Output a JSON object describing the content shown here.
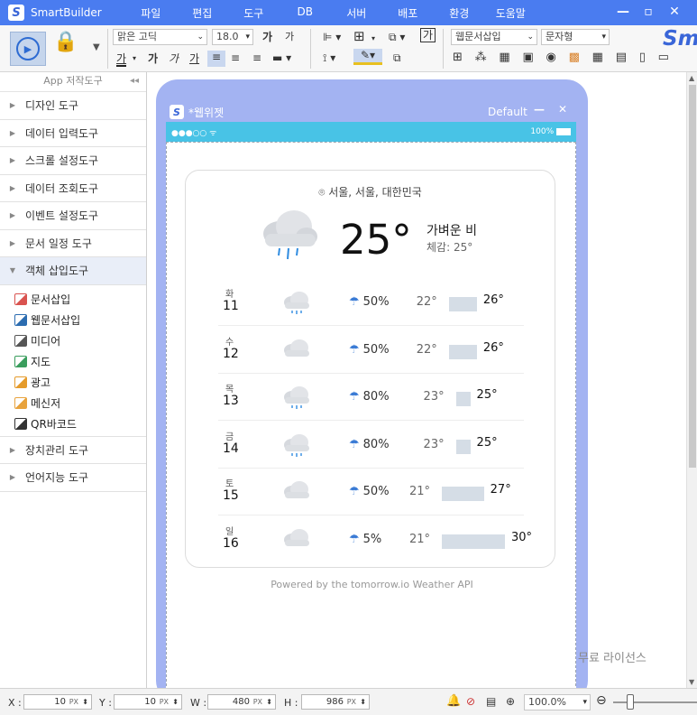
{
  "app": {
    "title": "SmartBuilder",
    "logo": "S"
  },
  "menu": [
    "파일",
    "편집",
    "도구",
    "DB",
    "서버",
    "배포",
    "환경",
    "도움말"
  ],
  "toolbar": {
    "font_name": "맑은 고딕",
    "font_size": "18.0",
    "widget_select": "웹문서삽입",
    "text_type": "문자형",
    "bold_glyph": "가",
    "italic_glyph": "가",
    "under_glyph": "가",
    "underline_glyph": "가",
    "increase_glyph": "가",
    "decrease_glyph": "가",
    "textbox_glyph": "가",
    "brand_partial": "Sm"
  },
  "left_panel": {
    "header": "App 저작도구",
    "sections_top": [
      "디자인 도구",
      "데이터 입력도구",
      "스크롤 설정도구",
      "데이터 조회도구",
      "이벤트 설정도구",
      "문서 일정 도구",
      "객체 삽입도구"
    ],
    "items": [
      {
        "label": "문서삽입",
        "color": "#d9534f"
      },
      {
        "label": "웹문서삽입",
        "color": "#2b6cb0"
      },
      {
        "label": "미디어",
        "color": "#555555"
      },
      {
        "label": "지도",
        "color": "#3a9d5d"
      },
      {
        "label": "광고",
        "color": "#e59b2b"
      },
      {
        "label": "메신저",
        "color": "#e8a33d"
      },
      {
        "label": "QR바코드",
        "color": "#333333"
      }
    ],
    "sections_bottom": [
      "장치관리 도구",
      "언어지능 도구"
    ]
  },
  "frame": {
    "title": "*웹위젯",
    "preset": "Default",
    "status_left": "●●●○○ ᯤ",
    "battery": "100%"
  },
  "weather": {
    "location": "서울, 서울, 대한민국",
    "temp": "25°",
    "condition": "가벼운 비",
    "feels_like": "체감: 25°",
    "days": [
      {
        "name": "화",
        "num": "11",
        "icon": "rain",
        "pop": "50%",
        "lo": "22°",
        "hi": "26°",
        "lo_val": 22,
        "hi_val": 26
      },
      {
        "name": "수",
        "num": "12",
        "icon": "cloud",
        "pop": "50%",
        "lo": "22°",
        "hi": "26°",
        "lo_val": 22,
        "hi_val": 26
      },
      {
        "name": "목",
        "num": "13",
        "icon": "rain",
        "pop": "80%",
        "lo": "23°",
        "hi": "25°",
        "lo_val": 23,
        "hi_val": 25
      },
      {
        "name": "금",
        "num": "14",
        "icon": "rain",
        "pop": "80%",
        "lo": "23°",
        "hi": "25°",
        "lo_val": 23,
        "hi_val": 25
      },
      {
        "name": "토",
        "num": "15",
        "icon": "cloud",
        "pop": "50%",
        "lo": "21°",
        "hi": "27°",
        "lo_val": 21,
        "hi_val": 27
      },
      {
        "name": "일",
        "num": "16",
        "icon": "cloud",
        "pop": "5%",
        "lo": "21°",
        "hi": "30°",
        "lo_val": 21,
        "hi_val": 30
      }
    ],
    "powered": "Powered by the tomorrow.io Weather API"
  },
  "license": "무료 라이선스",
  "status": {
    "x_label": "X :",
    "x": "10",
    "y_label": "Y :",
    "y": "10",
    "w_label": "W :",
    "w": "480",
    "h_label": "H :",
    "h": "986",
    "unit": "PX",
    "zoom": "100.0%"
  },
  "colors": {
    "accent": "#4a7cf0",
    "frame": "#a3b3f2",
    "phone_status": "#48c3e6"
  }
}
